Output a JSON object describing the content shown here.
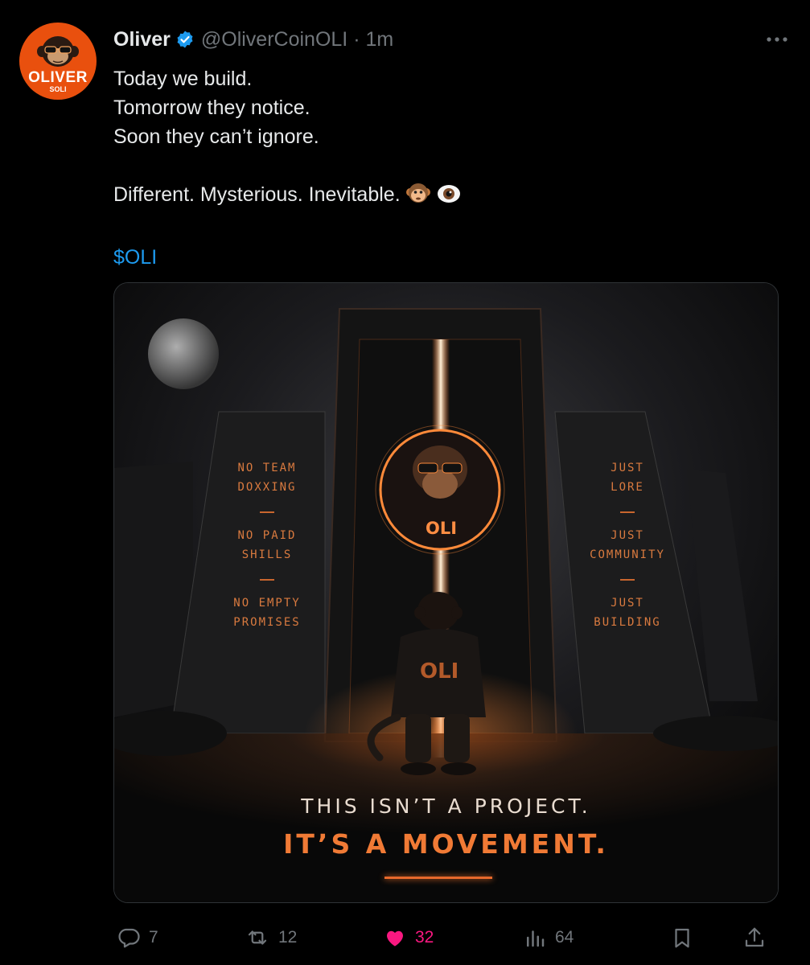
{
  "author": {
    "name": "Oliver",
    "handle": "@OliverCoinOLI",
    "time": "1m",
    "verified": true,
    "avatar_brand": "OLIVER",
    "avatar_sub": "SOLI"
  },
  "post": {
    "lines": [
      "Today we build.",
      "Tomorrow they notice.",
      "Soon they can’t ignore.",
      "",
      "Different. Mysterious. Inevitable."
    ],
    "emojis": [
      "monkey-face-icon",
      "eye-icon"
    ],
    "cashtag": "$OLI"
  },
  "media": {
    "left_pillar": [
      "NO TEAM",
      "DOXXING",
      "NO PAID",
      "SHILLS",
      "NO EMPTY",
      "PROMISES"
    ],
    "right_pillar": [
      "JUST",
      "LORE",
      "JUST",
      "COMMUNITY",
      "JUST",
      "BUILDING"
    ],
    "badge_text": "OLI",
    "hoodie_text": "OLI",
    "headline_1": "THIS ISN’T A PROJECT.",
    "headline_2": "IT’S A MOVEMENT."
  },
  "actions": {
    "replies": "7",
    "reposts": "12",
    "likes": "32",
    "views": "64"
  },
  "colors": {
    "accent_blue": "#1d9bf0",
    "like_pink": "#f91880",
    "brand_orange": "#e9500e",
    "muted": "#71767b"
  }
}
